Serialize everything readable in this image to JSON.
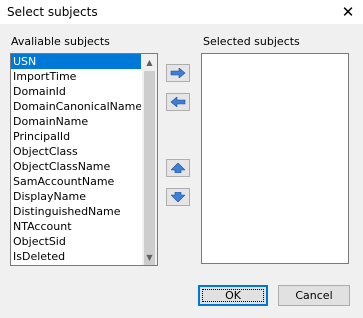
{
  "dialog": {
    "title": "Select subjects",
    "close_glyph": "✕"
  },
  "available": {
    "label": "Avaliable subjects",
    "selected_index": 0,
    "items": [
      "USN",
      "ImportTime",
      "DomainId",
      "DomainCanonicalName",
      "DomainName",
      "PrincipalId",
      "ObjectClass",
      "ObjectClassName",
      "SamAccountName",
      "DisplayName",
      "DistinguishedName",
      "NTAccount",
      "ObjectSid",
      "IsDeleted"
    ],
    "scroll_up_glyph": "▲",
    "scroll_down_glyph": "▼"
  },
  "selected": {
    "label": "Selected subjects",
    "items": []
  },
  "actions": {
    "add_icon": "arrow-right-icon",
    "remove_icon": "arrow-left-icon",
    "move_up_icon": "arrow-up-icon",
    "move_down_icon": "arrow-down-icon"
  },
  "buttons": {
    "ok_label": "OK",
    "cancel_label": "Cancel"
  },
  "colors": {
    "selection": "#0078d7",
    "arrow_fill": "#3c7fd6"
  }
}
